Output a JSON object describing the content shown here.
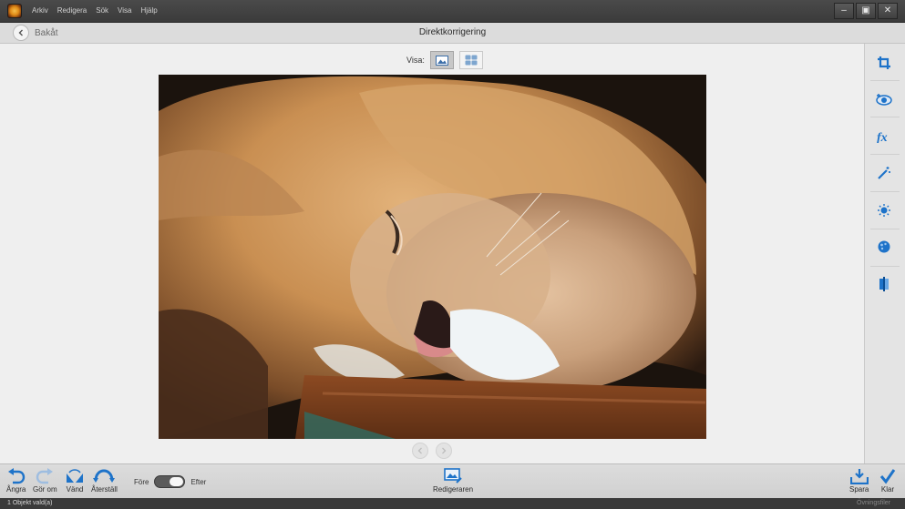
{
  "menu": {
    "items": [
      "Arkiv",
      "Redigera",
      "Sök",
      "Visa",
      "Hjälp"
    ]
  },
  "window_controls": {
    "minimize": "‒",
    "maximize": "▣",
    "close": "✕"
  },
  "header": {
    "back_label": "Bakåt",
    "title": "Direktkorrigering"
  },
  "view": {
    "label": "Visa:",
    "selected": "single-view"
  },
  "right_tools": [
    "crop-icon",
    "red-eye-icon",
    "fx-icon",
    "magic-wand-icon",
    "brightness-icon",
    "color-icon",
    "sharpen-icon"
  ],
  "bottom": {
    "undo_label": "Ångra",
    "redo_label": "Gör om",
    "rotate_label": "Vänd",
    "reset_label": "Återställ",
    "before_label": "Före",
    "after_label": "Efter",
    "editor_label": "Redigeraren",
    "save_label": "Spara",
    "done_label": "Klar"
  },
  "status": {
    "left": "1 Objekt vald(a)",
    "right": "Övningsfiler"
  },
  "colors": {
    "accent": "#1e73c9",
    "titlebar": "#3f3f3f",
    "panel": "#e4e4e4"
  }
}
